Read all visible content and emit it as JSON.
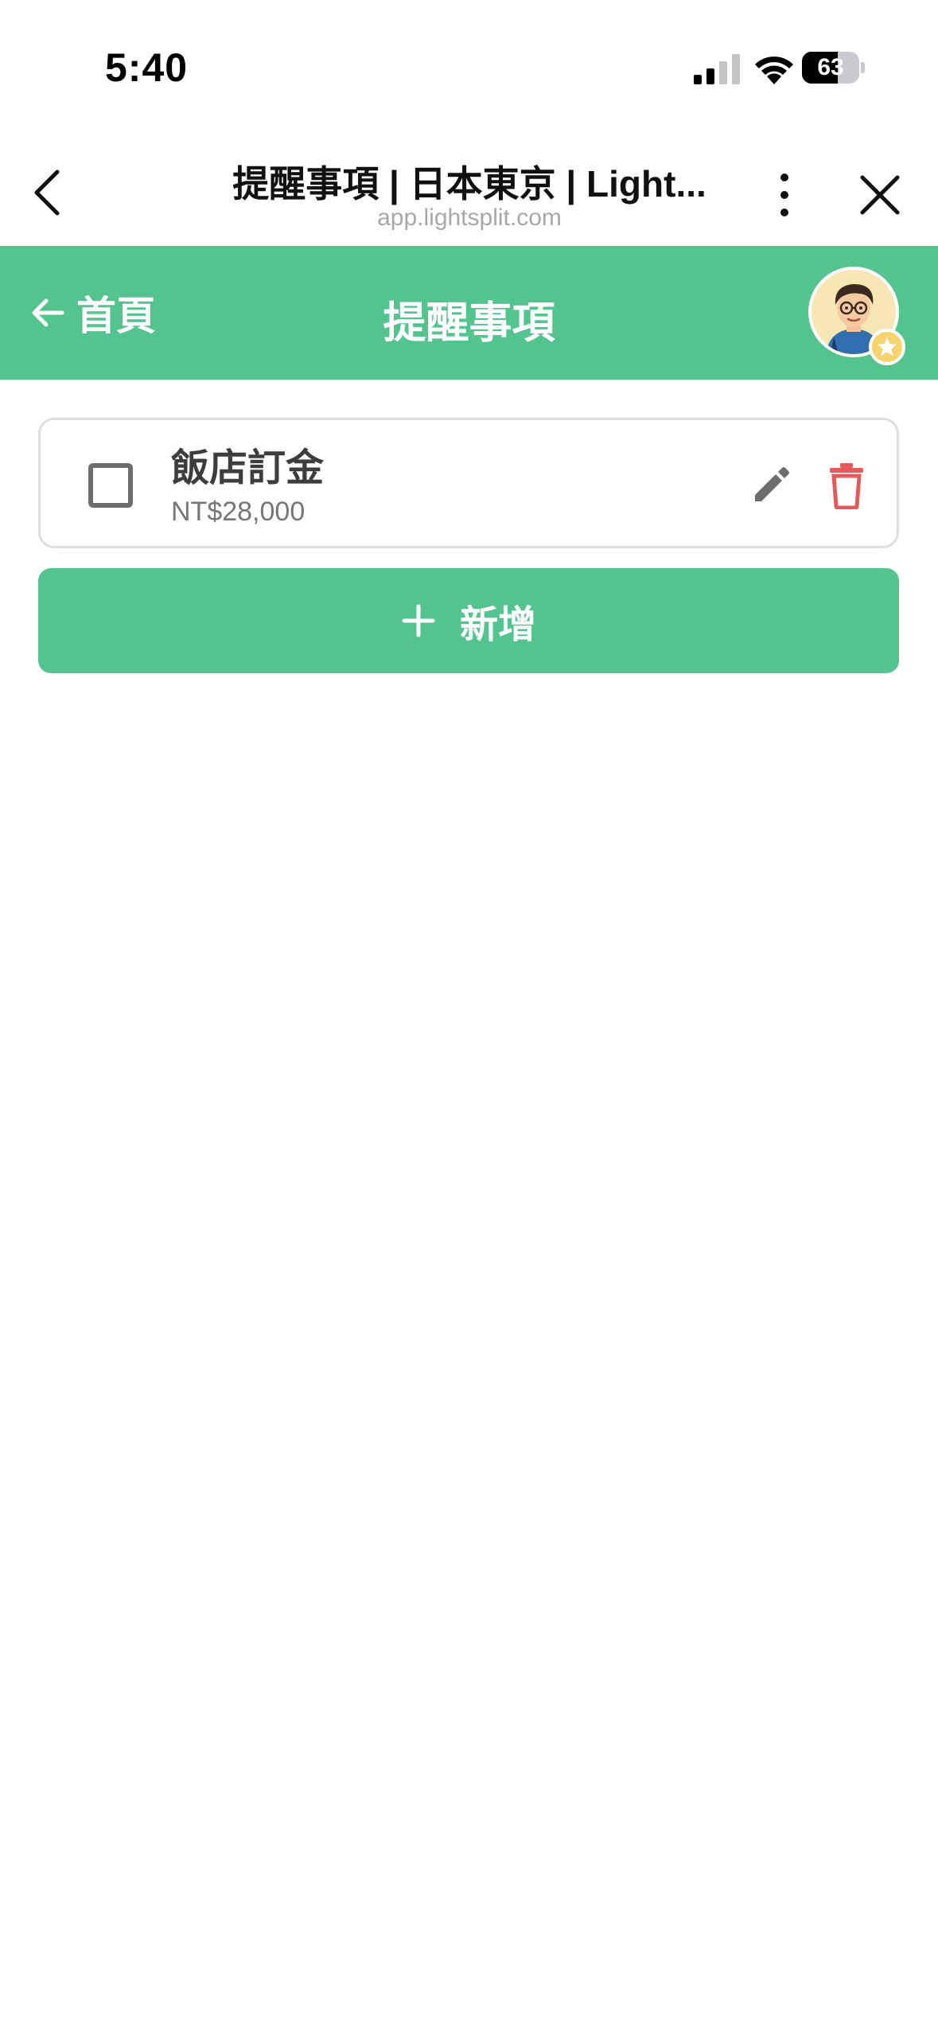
{
  "status_bar": {
    "time": "5:40",
    "battery_percent": 63,
    "battery_label": "63"
  },
  "browser": {
    "title": "提醒事項 | 日本東京 | Light...",
    "url": "app.lightsplit.com"
  },
  "header": {
    "back_label": "首頁",
    "title": "提醒事項"
  },
  "reminders": [
    {
      "title": "飯店訂金",
      "amount": "NT$28,000",
      "checked": false
    }
  ],
  "add_button": {
    "label": "新增"
  },
  "colors": {
    "brand_green": "#53c48d",
    "delete_red": "#e45b5b",
    "edit_gray": "#6d6d6d"
  },
  "icons": {
    "back": "chevron-left-icon",
    "more": "more-vertical-icon",
    "close": "close-icon",
    "home_arrow": "arrow-left-icon",
    "edit": "pencil-icon",
    "delete": "trash-icon",
    "add": "plus-icon"
  }
}
